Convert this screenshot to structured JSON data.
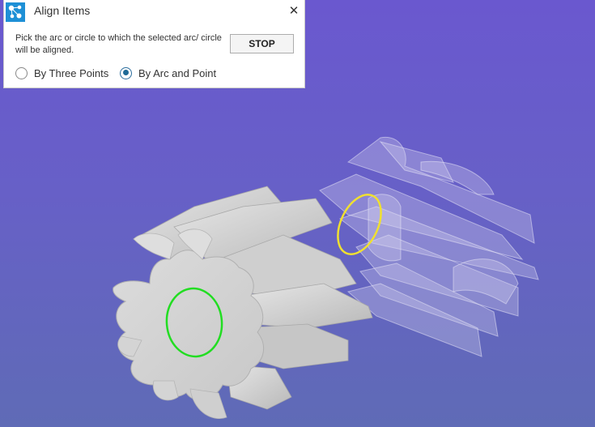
{
  "dialog": {
    "title": "Align Items",
    "close_icon": "close-icon",
    "instruction": "Pick the arc or circle to which the selected arc/ circle will be aligned.",
    "stop_label": "STOP",
    "options": [
      {
        "label": "By Three Points",
        "selected": false
      },
      {
        "label": "By Arc and Point",
        "selected": true
      }
    ]
  },
  "viewport": {
    "background": "#6a5dc9",
    "selected_arc_color": "#22dd22",
    "target_arc_color": "#f0e030"
  }
}
